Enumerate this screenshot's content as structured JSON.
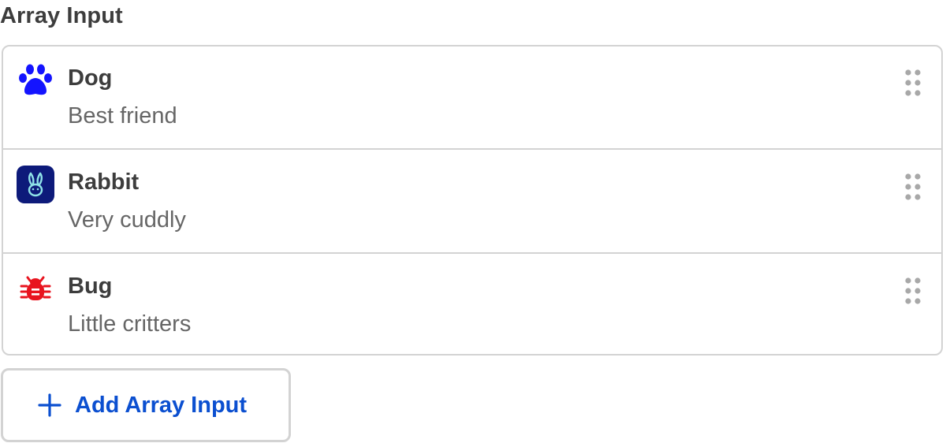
{
  "field": {
    "label": "Array Input"
  },
  "items": [
    {
      "title": "Dog",
      "description": "Best friend",
      "icon": "paw-icon",
      "icon_color": "#1414ff"
    },
    {
      "title": "Rabbit",
      "description": "Very cuddly",
      "icon": "rabbit-icon",
      "icon_color": "#0d1a7a"
    },
    {
      "title": "Bug",
      "description": "Little critters",
      "icon": "bug-icon",
      "icon_color": "#e8141f"
    }
  ],
  "add_button": {
    "label": "Add Array Input",
    "icon": "plus-icon",
    "color": "#0b4fd0"
  },
  "colors": {
    "border": "#d3d3d3",
    "title_text": "#3d3d3d",
    "desc_text": "#666666",
    "handle": "#a8a8a8"
  }
}
